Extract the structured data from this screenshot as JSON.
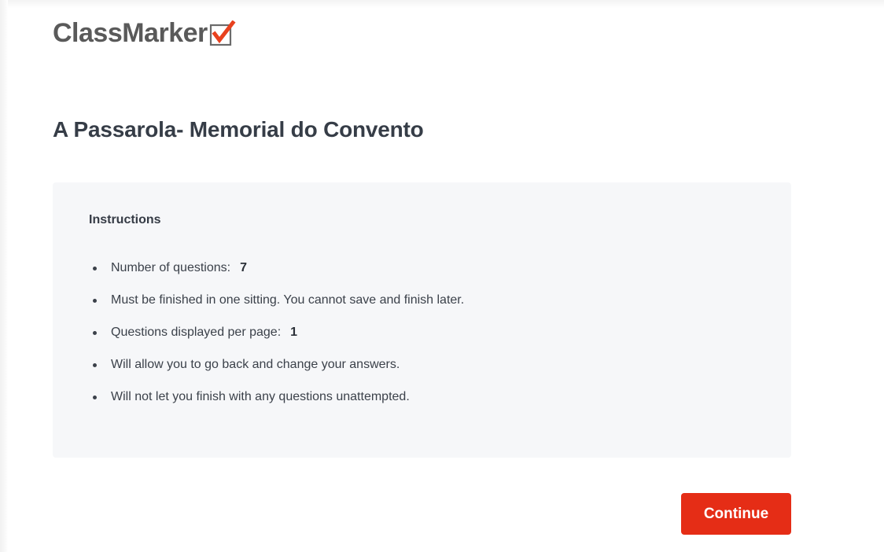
{
  "logo": {
    "text": "ClassMarker",
    "icon": "checkbox-check-icon",
    "check_color": "#e8411e",
    "text_color": "#5a5a5a"
  },
  "quiz": {
    "title": "A Passarola- Memorial do Convento"
  },
  "instructions": {
    "heading": "Instructions",
    "items": [
      {
        "text": "Number of questions:",
        "value": "7"
      },
      {
        "text": "Must be finished in one sitting. You cannot save and finish later.",
        "value": ""
      },
      {
        "text": "Questions displayed per page:",
        "value": "1"
      },
      {
        "text": "Will allow you to go back and change your answers.",
        "value": ""
      },
      {
        "text": "Will not let you finish with any questions unattempted.",
        "value": ""
      }
    ]
  },
  "actions": {
    "continue_label": "Continue",
    "continue_color": "#e52d16"
  }
}
